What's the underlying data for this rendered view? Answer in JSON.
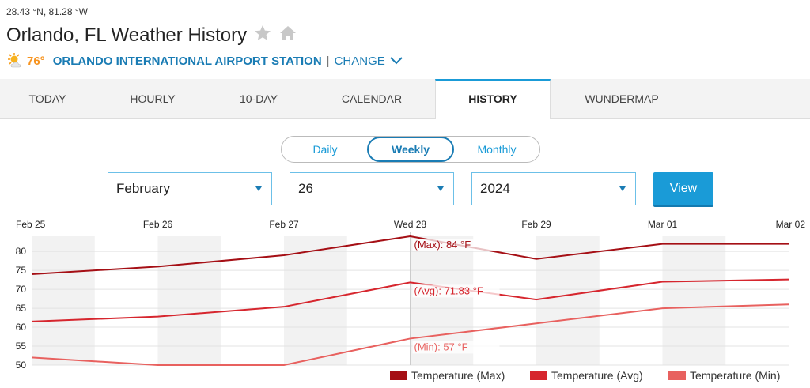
{
  "location": {
    "coords": "28.43 °N, 81.28 °W",
    "title": "Orlando, FL Weather History",
    "current_temp": "76°",
    "station": "ORLANDO INTERNATIONAL AIRPORT STATION",
    "separator": "|",
    "change_label": "CHANGE"
  },
  "tabs": [
    {
      "label": "TODAY"
    },
    {
      "label": "HOURLY"
    },
    {
      "label": "10-DAY"
    },
    {
      "label": "CALENDAR"
    },
    {
      "label": "HISTORY",
      "active": true
    },
    {
      "label": "WUNDERMAP"
    }
  ],
  "view_modes": [
    {
      "label": "Daily"
    },
    {
      "label": "Weekly",
      "active": true
    },
    {
      "label": "Monthly"
    }
  ],
  "filters": {
    "month": "February",
    "day": "26",
    "year": "2024",
    "view_label": "View"
  },
  "colors": {
    "accent": "#1a9bd7",
    "link": "#1a7cb4",
    "temp_current": "#f7931e",
    "max": "#a50f15",
    "avg": "#d6262e",
    "min": "#e8615f"
  },
  "icons": {
    "weather": "partly-cloudy-sun-icon",
    "favorite": "star-icon",
    "home": "home-icon",
    "change": "chevron-down-icon"
  },
  "chart_data": {
    "type": "line",
    "categories": [
      "Feb 25",
      "Feb 26",
      "Feb 27",
      "Wed 28",
      "Feb 29",
      "Mar 01",
      "Mar 02"
    ],
    "series": [
      {
        "name": "Temperature (Max)",
        "values": [
          74,
          76,
          79,
          84,
          78,
          82,
          82
        ]
      },
      {
        "name": "Temperature (Avg)",
        "values": [
          61.5,
          62.8,
          65.4,
          71.83,
          67.3,
          72,
          72.6
        ]
      },
      {
        "name": "Temperature (Min)",
        "values": [
          52,
          50,
          50,
          57,
          61,
          65,
          66
        ]
      }
    ],
    "ylim": [
      50,
      84
    ],
    "yticks": [
      50,
      55,
      60,
      65,
      70,
      75,
      80
    ],
    "highlighted_index": 3,
    "tooltip_labels": [
      "(Max): 84 °F",
      "(Avg): 71.83 °F",
      "(Min): 57 °F"
    ],
    "legend_position": "bottom-right",
    "grid": true
  }
}
